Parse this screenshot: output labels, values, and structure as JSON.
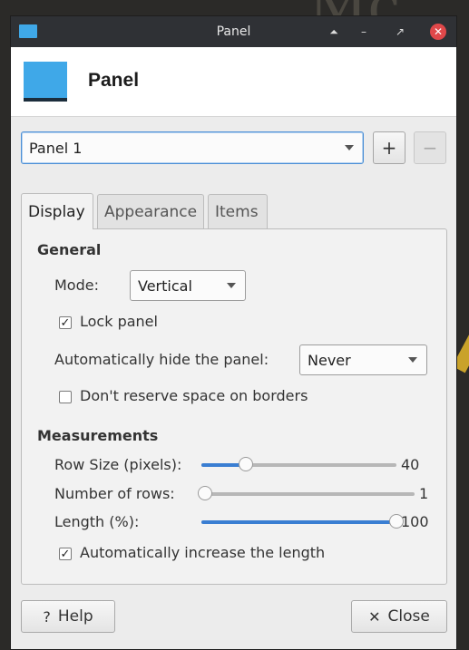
{
  "window": {
    "title": "Panel"
  },
  "header": {
    "title": "Panel",
    "icon": "panel-icon"
  },
  "panel_select": {
    "value": "Panel 1"
  },
  "buttons": {
    "add": "+",
    "remove": "−",
    "help": "Help",
    "close": "Close"
  },
  "tabs": [
    {
      "label": "Display",
      "active": true
    },
    {
      "label": "Appearance",
      "active": false
    },
    {
      "label": "Items",
      "active": false
    }
  ],
  "general": {
    "title": "General",
    "mode_label": "Mode:",
    "mode_value": "Vertical",
    "lock_panel_label": "Lock panel",
    "lock_panel_checked": true,
    "autohide_label": "Automatically hide the panel:",
    "autohide_value": "Never",
    "dont_reserve_label": "Don't reserve space on borders",
    "dont_reserve_checked": false
  },
  "measurements": {
    "title": "Measurements",
    "row_size_label": "Row Size (pixels):",
    "row_size_value": "40",
    "row_size_fraction": 0.23,
    "rows_label": "Number of rows:",
    "rows_value": "1",
    "rows_fraction": 0.0,
    "length_label": "Length (%):",
    "length_value": "100",
    "length_fraction": 1.0,
    "auto_increase_label": "Automatically increase the length",
    "auto_increase_checked": true
  },
  "colors": {
    "accent": "#3a7ed2",
    "panel_icon": "#3fa8e8",
    "close_button": "#e0484a"
  }
}
